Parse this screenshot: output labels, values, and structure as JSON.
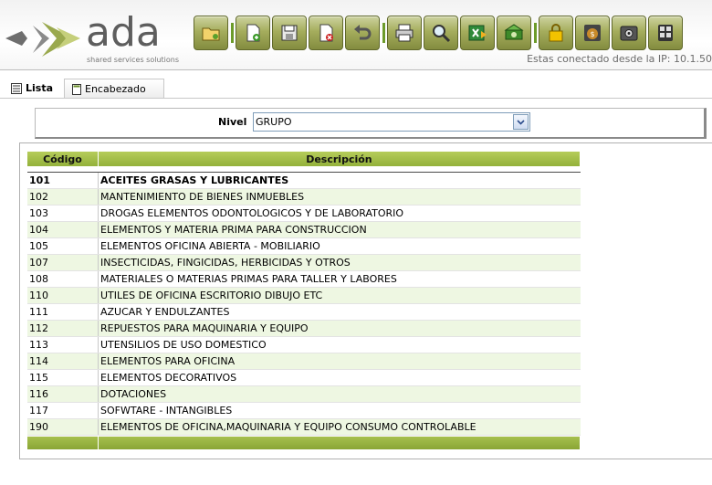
{
  "header": {
    "logo_word": "ada",
    "logo_tagline": "shared services solutions",
    "ip_text": "Estas conectado desde la IP: 10.1.50",
    "accent_color": "#9aa94e",
    "toolbar": [
      {
        "name": "open-folder-icon",
        "group": 1
      },
      {
        "name": "new-document-icon",
        "group": 2
      },
      {
        "name": "save-icon",
        "group": 2
      },
      {
        "name": "delete-icon",
        "group": 2
      },
      {
        "name": "undo-icon",
        "group": 2
      },
      {
        "name": "print-icon",
        "group": 3
      },
      {
        "name": "search-icon",
        "group": 3
      },
      {
        "name": "excel-export-icon",
        "group": 3
      },
      {
        "name": "money-icon",
        "group": 3
      },
      {
        "name": "lock-icon",
        "group": 4
      },
      {
        "name": "money-bag-icon",
        "group": 4
      },
      {
        "name": "safe-icon",
        "group": 4
      },
      {
        "name": "calculator-icon",
        "group": 4
      }
    ]
  },
  "tabs": [
    {
      "label": "Lista",
      "active": true,
      "icon": "list-icon"
    },
    {
      "label": "Encabezado",
      "active": false,
      "icon": "header-doc-icon"
    }
  ],
  "filter": {
    "label": "Nivel",
    "selected": "GRUPO"
  },
  "grid": {
    "columns": [
      "Código",
      "Descripción"
    ],
    "header_color": "#a3bd49",
    "alt_row_color": "#eef7e2",
    "rows": [
      {
        "code": "101",
        "desc": "ACEITES GRASAS Y LUBRICANTES"
      },
      {
        "code": "102",
        "desc": "MANTENIMIENTO DE BIENES INMUEBLES"
      },
      {
        "code": "103",
        "desc": "DROGAS ELEMENTOS ODONTOLOGICOS Y DE LABORATORIO"
      },
      {
        "code": "104",
        "desc": "ELEMENTOS Y MATERIA PRIMA PARA CONSTRUCCION"
      },
      {
        "code": "105",
        "desc": "ELEMENTOS OFICINA ABIERTA - MOBILIARIO"
      },
      {
        "code": "107",
        "desc": "INSECTICIDAS, FINGICIDAS, HERBICIDAS Y OTROS"
      },
      {
        "code": "108",
        "desc": "MATERIALES O MATERIAS PRIMAS PARA TALLER Y LABORES"
      },
      {
        "code": "110",
        "desc": "UTILES DE OFICINA ESCRITORIO DIBUJO ETC"
      },
      {
        "code": "111",
        "desc": "AZUCAR Y ENDULZANTES"
      },
      {
        "code": "112",
        "desc": "REPUESTOS PARA MAQUINARIA Y EQUIPO"
      },
      {
        "code": "113",
        "desc": "UTENSILIOS DE USO DOMESTICO"
      },
      {
        "code": "114",
        "desc": "ELEMENTOS PARA OFICINA"
      },
      {
        "code": "115",
        "desc": "ELEMENTOS DECORATIVOS"
      },
      {
        "code": "116",
        "desc": "DOTACIONES"
      },
      {
        "code": "117",
        "desc": "SOFWTARE - INTANGIBLES"
      },
      {
        "code": "190",
        "desc": "ELEMENTOS DE OFICINA,MAQUINARIA Y EQUIPO CONSUMO CONTROLABLE"
      }
    ]
  }
}
